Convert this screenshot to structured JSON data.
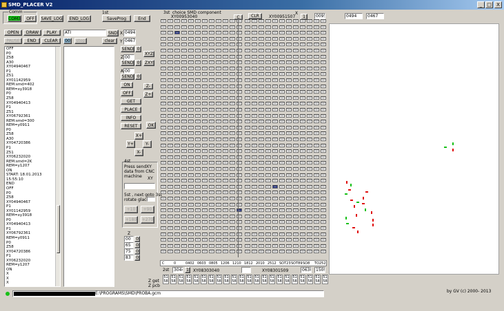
{
  "window": {
    "title": "SMD_PLACER V2",
    "minimize": "_",
    "maximize": "□",
    "close": "X"
  },
  "comm": {
    "label": "Comm",
    "com_value": "COM3",
    "off": "OFF",
    "save_log": "SAVE_LOG",
    "end_log": "END_LOG",
    "first_label": "1st",
    "save_prog": "SaveProg",
    "end": "End"
  },
  "program": {
    "open": "OPEN",
    "draw": "DRAW",
    "play": "PLAY",
    "pause": "PAUSE",
    "end": "END",
    "clear": "CLEAR",
    "cmd_input": "ATI",
    "snd": "SND",
    "x_label": "X",
    "x_value": "0494",
    "y_label": "Y",
    "y_value": "0467",
    "small_value": "00",
    "step": "step",
    "clear2": "clear"
  },
  "log_lines": [
    "OFF",
    "P0",
    "Z58",
    "A30",
    "XY04940467",
    "P1",
    "Z51",
    "XY01142959",
    "REM:smd=402",
    "REM=xy3918",
    "P0",
    "Z58",
    "XY04940413",
    "P1",
    "Z51",
    "XY06792361",
    "REM:smd=300",
    "REM=y0911",
    "P0",
    "Z58",
    "A30",
    "XY04720386",
    "P1",
    "Z51",
    "XY06232020",
    "REM:smd=2K",
    "REM=y1207",
    "ON",
    "START: 18.01.2013",
    "15:55:10",
    "END",
    "OFF",
    "P0",
    "Z58",
    "XY04940467",
    "P1",
    "XY01142959",
    "REM=xy3918",
    "P0",
    "XY04940413",
    "P1",
    "XY06792361",
    "REM=y0911",
    "P0",
    "Z58",
    "XY04720386",
    "P1",
    "XY06232020",
    "REM=y1207",
    "ON",
    "X",
    "X",
    "X"
  ],
  "controls": {
    "send": "SEND",
    "zero": "0",
    "xyz": "XYZ",
    "z_label": "Z",
    "z_value": "00",
    "zxy": "ZXY",
    "a_label": "A",
    "a_value": "00",
    "on": "ON",
    "off": "OFF",
    "zm": "Z-",
    "zp": "Z+",
    "get": "GET",
    "place": "PLACE",
    "info": "INFO",
    "reset": "RESET",
    "ok": "OK",
    "xp": "X+",
    "xm": "X-",
    "yp": "Y+",
    "ym": "Y-"
  },
  "step4": {
    "label": "4st",
    "text1": "Press sendXY",
    "text2": "data from CNC",
    "text3": "machine",
    "xy": "XY",
    "text5": "5st , next goto 3st",
    "rotate": "rotate glace",
    "p10": "+10",
    "p90": "+90",
    "p180": "+180",
    "p270": "+270"
  },
  "zlist": {
    "label": "Z",
    "values": [
      "00",
      "65",
      "75",
      "83"
    ]
  },
  "component": {
    "label3": "3st",
    "choice": "choice SMD component",
    "xy_code": "XY00953040",
    "c_btn": "C",
    "clr": "CLR",
    "xy_code2": "XY00951507",
    "x_mark": "X",
    "t_btn": "1",
    "count": "0095",
    "field1": "0494",
    "field2": "0467"
  },
  "bottom": {
    "labels_row": [
      "C",
      "0",
      "0402",
      "0603",
      "0805",
      "1206",
      "1210",
      "1812",
      "2010",
      "2512",
      "SOT23",
      "SOT89",
      "SO8",
      "TO252"
    ],
    "second": "2st",
    "xy_left_val": "3044",
    "xy_left_btn": "1",
    "xy_left": "XY08303040",
    "xy_right": "XY08301509",
    "right_val1": "0630",
    "right_val2": "1509",
    "z_get": "Z get",
    "z_pcb": "Z pcb",
    "get_vals": "51",
    "pcb_vals": "58"
  },
  "status": {
    "path": "E:\\PROGRAMS\\SMD\\PROBA.gcm",
    "copyright": "by  GV (c) 2000- 2013"
  },
  "colors": {
    "accent_green": "#18c018",
    "marker_red": "#e01010",
    "marker_green": "#18c018",
    "selected_cell": "#1a2a8a"
  }
}
